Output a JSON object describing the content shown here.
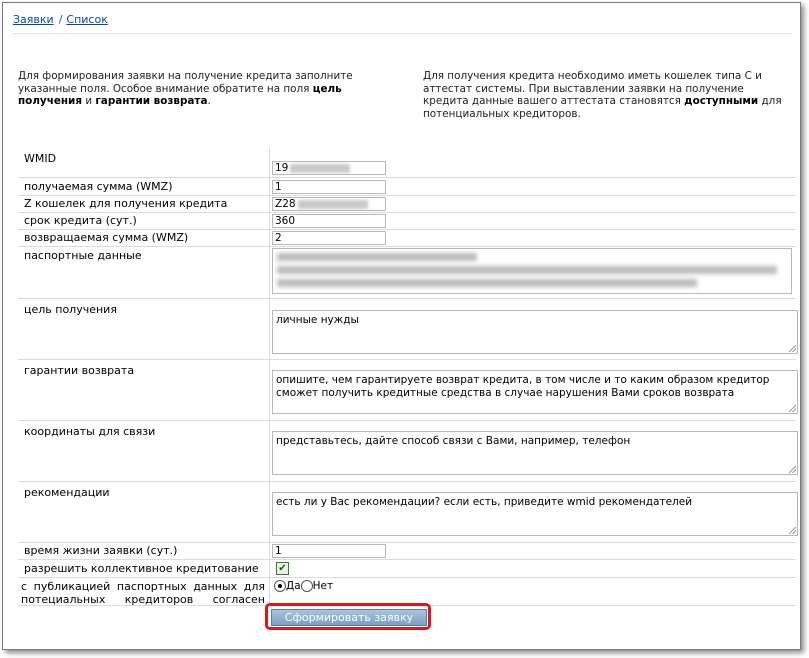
{
  "breadcrumb": {
    "link1": "Заявки",
    "separator": "/",
    "link2": "Список"
  },
  "intro_left": {
    "text1": "Для формирования заявки на получение кредита заполните указанные поля. Особое внимание обратите на поля ",
    "bold1": "цель получения",
    "text2": " и ",
    "bold2": "гарантии возврата",
    "text3": "."
  },
  "intro_right": {
    "text1": "Для получения кредита необходимо иметь кошелек типа C и аттестат системы. При выставлении заявки на получение кредита данные вашего аттестата становятся ",
    "bold1": "доступными",
    "text2": " для потенциальных кредиторов."
  },
  "form": {
    "wmid": {
      "label": "WMID",
      "value": "19"
    },
    "amount": {
      "label": "получаемая сумма (WMZ)",
      "value": "1"
    },
    "purse": {
      "label": "Z кошелек для получения кредита",
      "value": "Z28"
    },
    "term": {
      "label": "срок кредита (сут.)",
      "value": "360"
    },
    "return_amount": {
      "label": "возвращаемая сумма (WMZ)",
      "value": "2"
    },
    "passport": {
      "label": "паспортные данные"
    },
    "purpose": {
      "label": "цель получения",
      "value": "личные нужды"
    },
    "guarantees": {
      "label": "гарантии возврата",
      "value": "опишите, чем гарантируете возврат кредита, в том числе и то каким образом кредитор сможет получить кредитные средства в случае нарушения Вами сроков возврата"
    },
    "contacts": {
      "label": "координаты для связи",
      "value": "представьтесь, дайте способ связи с Вами, например, телефон"
    },
    "recommendations": {
      "label": "рекомендации",
      "value": "есть ли у Вас рекомендации? если есть, приведите wmid рекомендателей"
    },
    "lifetime": {
      "label": "время жизни заявки (сут.)",
      "value": "1"
    },
    "collective": {
      "label": "разрешить коллективное кредитование",
      "checked": true
    },
    "publish": {
      "label": "с публикацией паспортных данных для потециальных кредиторов согласен",
      "yes": "Да",
      "no": "Нет",
      "selected": "yes"
    }
  },
  "submit_label": "Сформировать заявку",
  "colors": {
    "link": "#0645ad",
    "highlight": "#e0161b",
    "button": "#7d9fc4"
  }
}
